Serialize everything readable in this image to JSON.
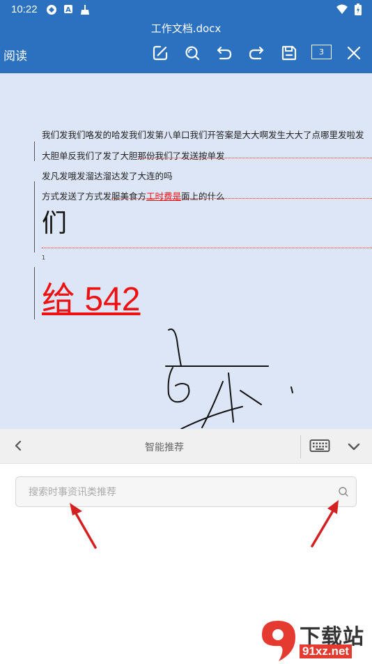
{
  "status_bar": {
    "time": "10:22",
    "icons": [
      "sync-icon",
      "a-badge-icon",
      "broom-icon"
    ],
    "right_icons": [
      "wifi-icon",
      "battery-icon"
    ]
  },
  "title_bar": {
    "doc_title": "工作文档.docx",
    "read_label": "阅读",
    "page_count": "3",
    "tools": [
      "edit-icon",
      "search-icon",
      "undo-icon",
      "redo-icon",
      "save-icon",
      "page-count-icon",
      "close-icon"
    ]
  },
  "document": {
    "line1": "我们发我们咯发的哈发我们发第八单口我们开答案是大大啊发生大大了点哪里发啦发",
    "line2": "大胆单反我们了发了大胆那份我们了发送按单发",
    "line3": "发凡发哦发溜达溜达发了大连的吗",
    "line4_a": "方式发送了方式发服美食方",
    "line4_b": "工时费是",
    "line4_c": "面上的什么",
    "big_char": "们",
    "small_num": "1",
    "big_text": "给 542"
  },
  "panel": {
    "title": "智能推荐",
    "search_placeholder": "搜索时事资讯类推荐"
  },
  "watermark": {
    "logo_text": "下载站",
    "logo_url": "91xz.net"
  },
  "colors": {
    "primary": "#2b71bf",
    "doc_bg": "#dce6f6",
    "revision_red": "#e11111",
    "arrow_red": "#d42020"
  }
}
